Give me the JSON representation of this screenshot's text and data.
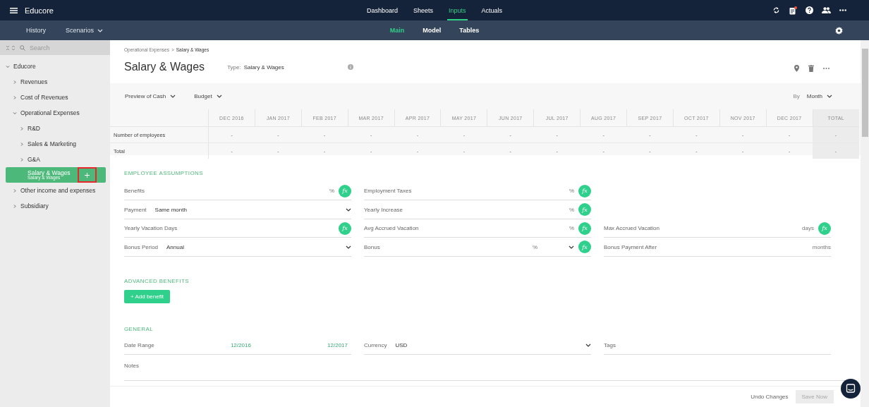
{
  "app": {
    "title": "Educore"
  },
  "top_tabs": [
    {
      "label": "Dashboard",
      "selected": false
    },
    {
      "label": "Sheets",
      "selected": false
    },
    {
      "label": "Inputs",
      "selected": true
    },
    {
      "label": "Actuals",
      "selected": false
    }
  ],
  "notifications": {
    "unread": true
  },
  "sub_nav": {
    "left": [
      {
        "label": "History",
        "dropdown": false
      },
      {
        "label": "Scenarios",
        "dropdown": true
      }
    ],
    "tabs": [
      {
        "label": "Main",
        "selected": true
      },
      {
        "label": "Model",
        "selected": false
      },
      {
        "label": "Tables",
        "selected": false
      }
    ]
  },
  "sidebar": {
    "search_placeholder": "Search",
    "tree": [
      {
        "label": "Educore",
        "expanded": true,
        "selected": false,
        "children": [
          {
            "label": "Revenues",
            "expanded": false,
            "selected": false
          },
          {
            "label": "Cost of Revenues",
            "expanded": false,
            "selected": false
          },
          {
            "label": "Operational Expenses",
            "expanded": true,
            "selected": false,
            "children": [
              {
                "label": "R&D",
                "expanded": false,
                "selected": false
              },
              {
                "label": "Sales & Marketing",
                "expanded": false,
                "selected": false
              },
              {
                "label": "G&A",
                "expanded": false,
                "selected": false
              },
              {
                "label": "Salary & Wages",
                "subtitle": "Salary & Wages",
                "selected": true
              }
            ]
          },
          {
            "label": "Other income and expenses",
            "expanded": false,
            "selected": false
          },
          {
            "label": "Subsidiary",
            "expanded": false,
            "selected": false
          }
        ]
      }
    ]
  },
  "breadcrumb": [
    {
      "label": "Operational Expenses",
      "current": false
    },
    {
      "label": ">",
      "current": false
    },
    {
      "label": "Salary & Wages",
      "current": true
    }
  ],
  "header": {
    "title": "Salary & Wages",
    "type_label": "Type:",
    "type_value": "Salary & Wages"
  },
  "preview": {
    "dropdowns": [
      "Preview of Cash",
      "Budget"
    ],
    "by_label": "By",
    "by_value": "Month"
  },
  "table": {
    "columns": [
      {
        "label": "DEC 2016",
        "kind": "month"
      },
      {
        "label": "JAN 2017",
        "kind": "month"
      },
      {
        "label": "FEB 2017",
        "kind": "month"
      },
      {
        "label": "MAR 2017",
        "kind": "month"
      },
      {
        "label": "APR 2017",
        "kind": "month"
      },
      {
        "label": "MAY 2017",
        "kind": "month"
      },
      {
        "label": "JUN 2017",
        "kind": "month"
      },
      {
        "label": "JUL 2017",
        "kind": "month"
      },
      {
        "label": "AUG 2017",
        "kind": "month"
      },
      {
        "label": "SEP 2017",
        "kind": "month"
      },
      {
        "label": "OCT 2017",
        "kind": "month"
      },
      {
        "label": "NOV 2017",
        "kind": "month"
      },
      {
        "label": "DEC 2017",
        "kind": "month"
      },
      {
        "label": "TOTAL",
        "kind": "total"
      }
    ],
    "rows": [
      {
        "label": "Number of employees",
        "cells": [
          "-",
          "-",
          "-",
          "-",
          "-",
          "-",
          "-",
          "-",
          "-",
          "-",
          "-",
          "-",
          "-",
          "-"
        ]
      },
      {
        "label": "Total",
        "cells": [
          "-",
          "-",
          "-",
          "-",
          "-",
          "-",
          "-",
          "-",
          "-",
          "-",
          "-",
          "-",
          "-",
          "-"
        ]
      }
    ]
  },
  "employee_assumptions": {
    "title": "EMPLOYEE ASSUMPTIONS",
    "rows": [
      [
        {
          "kind": "input",
          "label": "Benefits",
          "unit": "%",
          "formula": "fx"
        },
        {
          "kind": "input",
          "label": "Employment Taxes",
          "unit": "%",
          "formula": "fx"
        }
      ],
      [
        {
          "kind": "select",
          "label": "Payment",
          "value": "Same month"
        },
        {
          "kind": "input",
          "label": "Yearly Increase",
          "unit": "%",
          "formula": "fx"
        }
      ],
      [
        {
          "kind": "input",
          "label": "Yearly Vacation Days",
          "formula": "fx"
        },
        {
          "kind": "input",
          "label": "Avg Accrued Vacation",
          "unit": "%",
          "formula": "fx"
        },
        {
          "kind": "input",
          "label": "Max Accrued Vacation",
          "unit": "days",
          "formula": "fx"
        }
      ],
      [
        {
          "kind": "select",
          "label": "Bonus Period",
          "value": "Annual"
        },
        {
          "kind": "select",
          "label": "Bonus",
          "unit": "%",
          "formula": "fx"
        },
        {
          "kind": "input",
          "label": "Bonus Payment After",
          "unit": "months"
        }
      ]
    ]
  },
  "advanced_benefits": {
    "title": "ADVANCED BENEFITS",
    "button": "+ Add benefit"
  },
  "general": {
    "title": "GENERAL",
    "fields": [
      {
        "kind": "range",
        "label": "Date Range",
        "values": [
          "12/2016",
          "12/2017"
        ]
      },
      {
        "kind": "select",
        "label": "Currency",
        "value": "USD"
      },
      {
        "kind": "input",
        "label": "Tags"
      }
    ],
    "notes_label": "Notes"
  },
  "footer": {
    "undo": "Undo Changes",
    "save": "Save Now",
    "save_disabled": true
  }
}
